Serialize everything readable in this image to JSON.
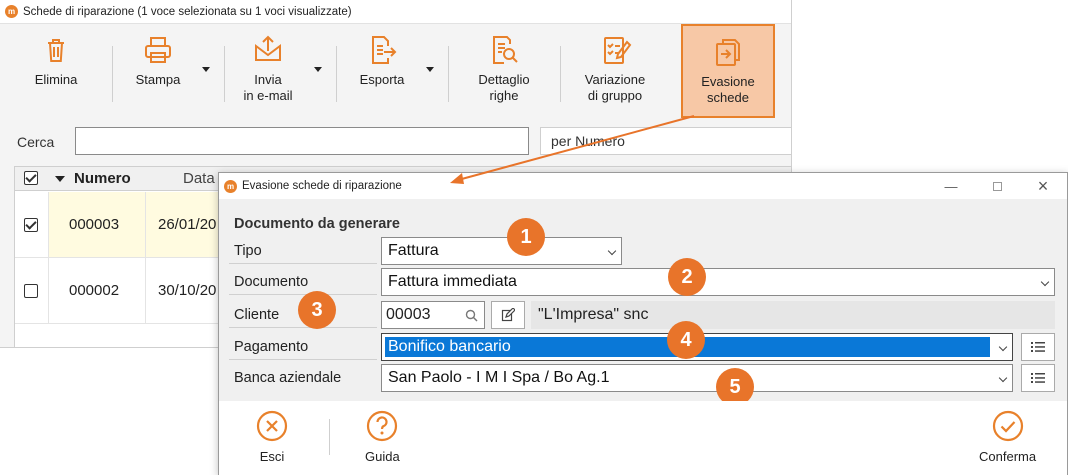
{
  "main_window": {
    "title": "Schede di riparazione (1 voce selezionata su 1 voci visualizzate)",
    "toolbar": {
      "elimina": "Elimina",
      "stampa": "Stampa",
      "invia_line1": "Invia",
      "invia_line2": "in e-mail",
      "esporta": "Esporta",
      "dettaglio_line1": "Dettaglio",
      "dettaglio_line2": "righe",
      "variazione_line1": "Variazione",
      "variazione_line2": "di gruppo",
      "evasione_line1": "Evasione",
      "evasione_line2": "schede"
    },
    "search": {
      "label": "Cerca",
      "value": "",
      "mode": "per Numero"
    },
    "grid": {
      "col_numero": "Numero",
      "col_data": "Data",
      "rows": [
        {
          "numero": "000003",
          "data": "26/01/20"
        },
        {
          "numero": "000002",
          "data": "30/10/20"
        }
      ]
    }
  },
  "dialog": {
    "title": "Evasione schede di riparazione",
    "section_title": "Documento da generare",
    "tipo_label": "Tipo",
    "tipo_value": "Fattura",
    "documento_label": "Documento",
    "documento_value": "Fattura immediata",
    "cliente_label": "Cliente",
    "cliente_code": "00003",
    "cliente_name": "\"L'Impresa\" snc",
    "pagamento_label": "Pagamento",
    "pagamento_value": "Bonifico bancario",
    "banca_label": "Banca aziendale",
    "banca_value": "San Paolo - I M I Spa / Bo Ag.1",
    "footer": {
      "esci": "Esci",
      "guida": "Guida",
      "conferma": "Conferma"
    }
  },
  "callouts": [
    "1",
    "2",
    "3",
    "4",
    "5"
  ],
  "colors": {
    "accent": "#e8812b",
    "badge": "#e8742a",
    "selection": "#0a78d7"
  }
}
